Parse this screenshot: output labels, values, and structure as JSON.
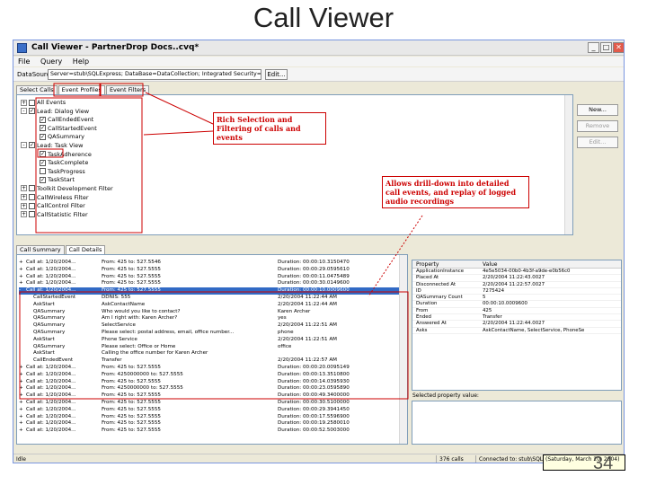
{
  "slide": {
    "title": "Call Viewer",
    "page_number": "34"
  },
  "window": {
    "title": "Call Viewer - PartnerDrop Docs..cvq*"
  },
  "menu": [
    "File",
    "Query",
    "Help"
  ],
  "datasource": {
    "label": "DataSource",
    "value": "Server=stub\\SQLExpress; DataBase=DataCollection; Integrated Security=",
    "edit_label": "Edit..."
  },
  "filter_tabs": [
    "Select Calls",
    "Event Profiles",
    "Event Filters"
  ],
  "filter_tree": [
    {
      "label": "All Events",
      "level": 0,
      "checked": false,
      "expand": "+"
    },
    {
      "label": "Lead: Dialog View",
      "level": 0,
      "checked": true,
      "expand": "-"
    },
    {
      "label": "CallEndedEvent",
      "level": 1,
      "checked": true,
      "expand": ""
    },
    {
      "label": "CallStartedEvent",
      "level": 1,
      "checked": true,
      "expand": ""
    },
    {
      "label": "QASummary",
      "level": 1,
      "checked": true,
      "expand": ""
    },
    {
      "label": "Lead: Task View",
      "level": 0,
      "checked": true,
      "expand": "-"
    },
    {
      "label": "TaskAdherence",
      "level": 1,
      "checked": true,
      "expand": ""
    },
    {
      "label": "TaskComplete",
      "level": 1,
      "checked": true,
      "expand": ""
    },
    {
      "label": "TaskProgress",
      "level": 1,
      "checked": false,
      "expand": ""
    },
    {
      "label": "TaskStart",
      "level": 1,
      "checked": true,
      "expand": ""
    },
    {
      "label": "Toolkit Development Filter",
      "level": 0,
      "checked": false,
      "expand": "+"
    },
    {
      "label": "CallWireless Filter",
      "level": 0,
      "checked": false,
      "expand": "+"
    },
    {
      "label": "CallControl Filter",
      "level": 0,
      "checked": false,
      "expand": "+"
    },
    {
      "label": "CallStatistic Filter",
      "level": 0,
      "checked": false,
      "expand": "+"
    }
  ],
  "side_buttons": [
    {
      "label": "New...",
      "disabled": false
    },
    {
      "label": "Remove",
      "disabled": true
    },
    {
      "label": "Edit...",
      "disabled": true
    }
  ],
  "detail_tabs": [
    "Call Summary",
    "Call Details"
  ],
  "call_rows": [
    {
      "expand": "+",
      "event": "Call at: 1/20/2004...",
      "detail": "From: 425 to: 527.5546",
      "time": "Duration: 00:00:10.3150470",
      "highlight": false
    },
    {
      "expand": "+",
      "event": "Call at: 1/20/2004...",
      "detail": "From: 425 to: 527.5555",
      "time": "Duration: 00:00:29.0595610",
      "highlight": false
    },
    {
      "expand": "+",
      "event": "Call at: 1/20/2004...",
      "detail": "From: 425 to: 527.5555",
      "time": "Duration: 00:00:11.0475489",
      "highlight": false
    },
    {
      "expand": "+",
      "event": "Call at: 1/20/2004...",
      "detail": "From: 425 to: 527.5555",
      "time": "Duration: 00:00:30.0149600",
      "highlight": false
    },
    {
      "expand": "-",
      "event": "Call at: 1/20/2004...",
      "detail": "From: 425 to: 527.5555",
      "time": "Duration: 00:00:10.0009600",
      "highlight": true
    },
    {
      "expand": "",
      "event": "CallStartedEvent",
      "detail": "DDNIS: 555",
      "time": "2/20/2004 11:22:44 AM",
      "highlight": false
    },
    {
      "expand": "",
      "event": "AskStart",
      "detail": "AskContactName",
      "time": "2/20/2004 11:22:44 AM",
      "highlight": false
    },
    {
      "expand": "",
      "event": "QASummary",
      "detail": "Who would you like to contact?",
      "time": "Karen Archer",
      "highlight": false
    },
    {
      "expand": "",
      "event": "QASummary",
      "detail": "Am I right with: Karen Archer?",
      "time": "yes",
      "highlight": false
    },
    {
      "expand": "",
      "event": "QASummary",
      "detail": "SelectService",
      "time": "2/20/2004 11:22:51 AM",
      "highlight": false
    },
    {
      "expand": "",
      "event": "QASummary",
      "detail": "Please select: postal address, email, office number...",
      "time": "phone",
      "highlight": false
    },
    {
      "expand": "",
      "event": "AskStart",
      "detail": "Phone Service",
      "time": "2/20/2004 11:22:51 AM",
      "highlight": false
    },
    {
      "expand": "",
      "event": "QASummary",
      "detail": "Please select: Office or Home",
      "time": "office",
      "highlight": false
    },
    {
      "expand": "",
      "event": "AskStart",
      "detail": "Calling the office number for Karen Archer",
      "time": "",
      "highlight": false
    },
    {
      "expand": "",
      "event": "CallEndedEvent",
      "detail": "Transfer",
      "time": "2/20/2004 11:22:57 AM",
      "highlight": false
    },
    {
      "expand": "+",
      "event": "Call at: 1/20/2004...",
      "detail": "From: 425 to: 527.5555",
      "time": "Duration: 00:00:20.0095149",
      "highlight": false
    },
    {
      "expand": "+",
      "event": "Call at: 1/20/2004...",
      "detail": "From: 4250000000 to: 527.5555",
      "time": "Duration: 00:00:13.3510800",
      "highlight": false
    },
    {
      "expand": "+",
      "event": "Call at: 1/20/2004...",
      "detail": "From: 425 to: 527.5555",
      "time": "Duration: 00:00:14.0395930",
      "highlight": false
    },
    {
      "expand": "+",
      "event": "Call at: 1/20/2004...",
      "detail": "From: 4250000000 to: 527.5555",
      "time": "Duration: 00:00:23.0595890",
      "highlight": false
    },
    {
      "expand": "+",
      "event": "Call at: 1/20/2004...",
      "detail": "From: 425 to: 527.5555",
      "time": "Duration: 00:00:49.3400000",
      "highlight": false
    },
    {
      "expand": "+",
      "event": "Call at: 1/20/2004...",
      "detail": "From: 425 to: 527.5555",
      "time": "Duration: 00:00:30.5100000",
      "highlight": false
    },
    {
      "expand": "+",
      "event": "Call at: 1/20/2004...",
      "detail": "From: 425 to: 527.5555",
      "time": "Duration: 00:00:29.3941450",
      "highlight": false
    },
    {
      "expand": "+",
      "event": "Call at: 1/20/2004...",
      "detail": "From: 425 to: 527.5555",
      "time": "Duration: 00:00:17.5596900",
      "highlight": false
    },
    {
      "expand": "+",
      "event": "Call at: 1/20/2004...",
      "detail": "From: 425 to: 527.5555",
      "time": "Duration: 00:00:19.2580010",
      "highlight": false
    },
    {
      "expand": "+",
      "event": "Call at: 1/20/2004...",
      "detail": "From: 425 to: 527.5555",
      "time": "Duration: 00:00:52.5003000",
      "highlight": false
    }
  ],
  "properties": {
    "headers": [
      "Property",
      "Value"
    ],
    "rows": [
      {
        "property": "ApplicationInstance",
        "value": "4e5e5034-00b0-4b3f-a9de-e0b56c0"
      },
      {
        "property": "Placed At",
        "value": "2/20/2004 11:22:43.0027"
      },
      {
        "property": "Disconnected At",
        "value": "2/20/2004 11:22:57.0027"
      },
      {
        "property": "ID",
        "value": "7275424"
      },
      {
        "property": "QASummary Count",
        "value": "5"
      },
      {
        "property": "Duration",
        "value": "00:00:10.0009600"
      },
      {
        "property": "From",
        "value": "425"
      },
      {
        "property": "Ended",
        "value": "Transfer"
      },
      {
        "property": "Answered At",
        "value": "2/20/2004 11:22:44.0027"
      },
      {
        "property": "Asks",
        "value": "AskContactName, SelectService, PhoneSe"
      }
    ],
    "selected_label": "Selected property value:"
  },
  "status": {
    "ready": "Idle",
    "calls": "376 calls",
    "connection": "Connected to: stub\\SQLExpress"
  },
  "tooltip": "(Saturday, March 20, 2004)",
  "callouts": [
    {
      "text": "Rich Selection and Filtering of calls and events"
    },
    {
      "text": "Allows drill-down into detailed call events, and replay of logged audio recordings"
    }
  ],
  "colors": {
    "annotation": "#cc0000",
    "selection": "#316ac5",
    "window_border": "#7a96df"
  }
}
